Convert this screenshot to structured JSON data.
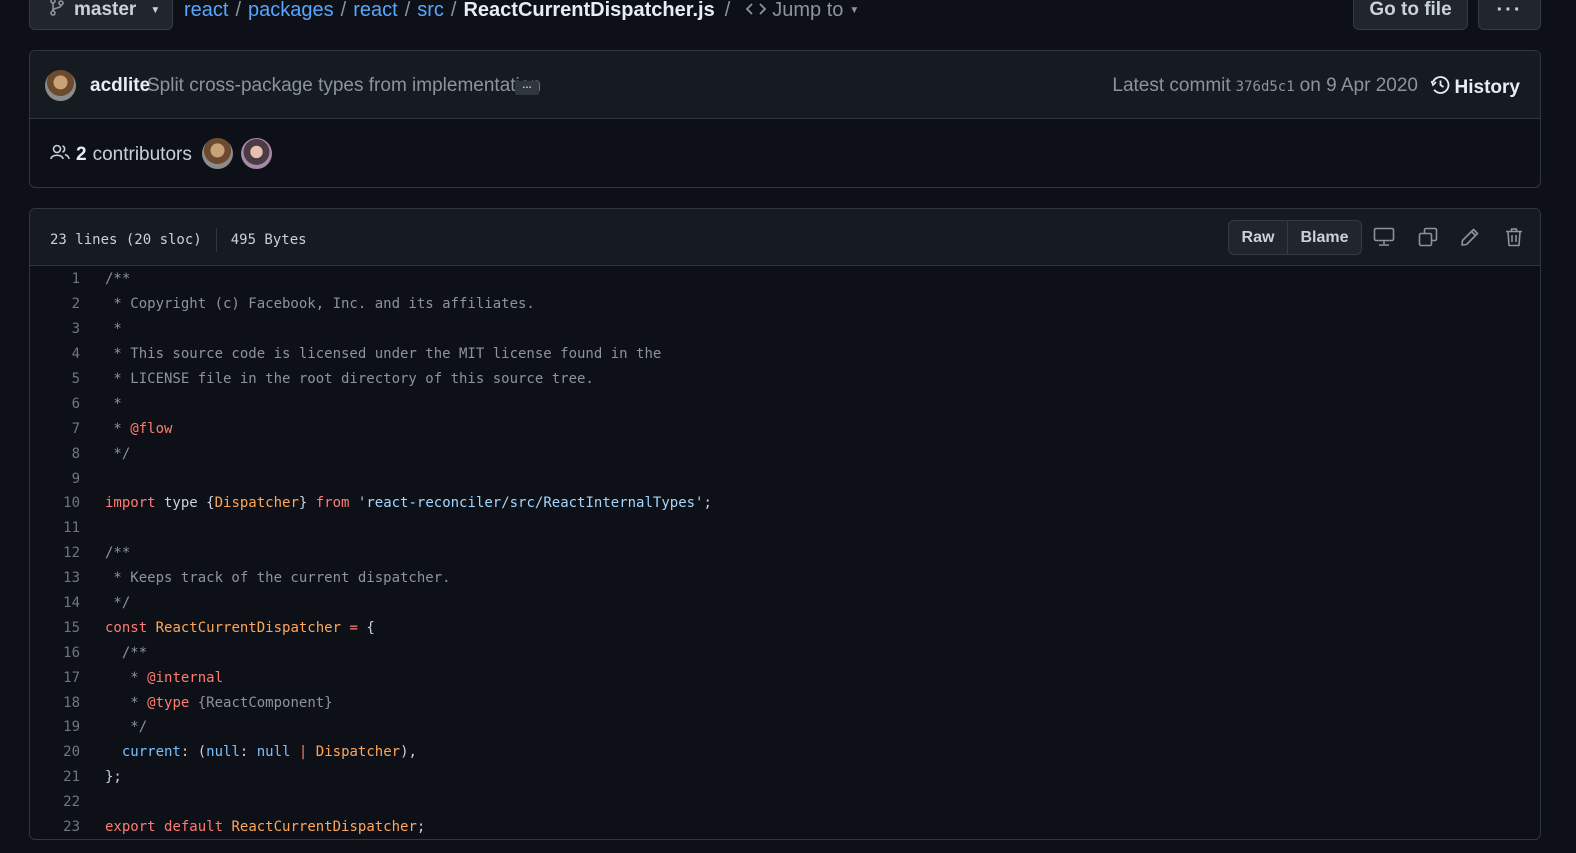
{
  "nav": {
    "branch": "master",
    "breadcrumb": [
      "react",
      "packages",
      "react",
      "src"
    ],
    "file_name": "ReactCurrentDispatcher.js",
    "jump_to": "Jump to",
    "go_to_file": "Go to file",
    "more": "···"
  },
  "commit": {
    "author": "acdlite",
    "message": "Split cross-package types from implementation",
    "ellipsis": "…",
    "latest_label": "Latest commit",
    "sha": "376d5c1",
    "date": "on 9 Apr 2020",
    "history": "History"
  },
  "contributors": {
    "count": "2",
    "label": "contributors"
  },
  "file": {
    "lines_info": "23 lines (20 sloc)",
    "size": "495 Bytes",
    "raw": "Raw",
    "blame": "Blame",
    "icons": [
      "desktop-icon",
      "copy-icon",
      "pencil-icon",
      "trash-icon"
    ]
  },
  "code": [
    {
      "n": "1",
      "parts": [
        [
          "c",
          "/**"
        ]
      ]
    },
    {
      "n": "2",
      "parts": [
        [
          "c",
          " * Copyright (c) Facebook, Inc. and its affiliates."
        ]
      ]
    },
    {
      "n": "3",
      "parts": [
        [
          "c",
          " *"
        ]
      ]
    },
    {
      "n": "4",
      "parts": [
        [
          "c",
          " * This source code is licensed under the MIT license found in the"
        ]
      ]
    },
    {
      "n": "5",
      "parts": [
        [
          "c",
          " * LICENSE file in the root directory of this source tree."
        ]
      ]
    },
    {
      "n": "6",
      "parts": [
        [
          "c",
          " *"
        ]
      ]
    },
    {
      "n": "7",
      "parts": [
        [
          "c",
          " * "
        ],
        [
          "k",
          "@flow"
        ]
      ]
    },
    {
      "n": "8",
      "parts": [
        [
          "c",
          " */"
        ]
      ]
    },
    {
      "n": "9",
      "parts": []
    },
    {
      "n": "10",
      "parts": [
        [
          "k",
          "import"
        ],
        [
          "p",
          " type {"
        ],
        [
          "t",
          "Dispatcher"
        ],
        [
          "p",
          "} "
        ],
        [
          "k",
          "from"
        ],
        [
          "p",
          " "
        ],
        [
          "s",
          "'react-reconciler/src/ReactInternalTypes'"
        ],
        [
          "p",
          ";"
        ]
      ]
    },
    {
      "n": "11",
      "parts": []
    },
    {
      "n": "12",
      "parts": [
        [
          "c",
          "/**"
        ]
      ]
    },
    {
      "n": "13",
      "parts": [
        [
          "c",
          " * Keeps track of the current dispatcher."
        ]
      ]
    },
    {
      "n": "14",
      "parts": [
        [
          "c",
          " */"
        ]
      ]
    },
    {
      "n": "15",
      "parts": [
        [
          "k",
          "const"
        ],
        [
          "p",
          " "
        ],
        [
          "t",
          "ReactCurrentDispatcher"
        ],
        [
          "p",
          " "
        ],
        [
          "k",
          "="
        ],
        [
          "p",
          " {"
        ]
      ]
    },
    {
      "n": "16",
      "parts": [
        [
          "c",
          "  /**"
        ]
      ]
    },
    {
      "n": "17",
      "parts": [
        [
          "c",
          "   * "
        ],
        [
          "k",
          "@internal"
        ]
      ]
    },
    {
      "n": "18",
      "parts": [
        [
          "c",
          "   * "
        ],
        [
          "k",
          "@type"
        ],
        [
          "c",
          " {ReactComponent}"
        ]
      ]
    },
    {
      "n": "19",
      "parts": [
        [
          "c",
          "   */"
        ]
      ]
    },
    {
      "n": "20",
      "parts": [
        [
          "p",
          "  "
        ],
        [
          "v",
          "current"
        ],
        [
          "p",
          ": ("
        ],
        [
          "v",
          "null"
        ],
        [
          "p",
          ": "
        ],
        [
          "v",
          "null"
        ],
        [
          "p",
          " "
        ],
        [
          "k",
          "|"
        ],
        [
          "p",
          " "
        ],
        [
          "t",
          "Dispatcher"
        ],
        [
          "p",
          "),"
        ]
      ]
    },
    {
      "n": "21",
      "parts": [
        [
          "p",
          "};"
        ]
      ]
    },
    {
      "n": "22",
      "parts": []
    },
    {
      "n": "23",
      "parts": [
        [
          "k",
          "export"
        ],
        [
          "p",
          " "
        ],
        [
          "k",
          "default"
        ],
        [
          "p",
          " "
        ],
        [
          "t",
          "ReactCurrentDispatcher"
        ],
        [
          "p",
          ";"
        ]
      ]
    }
  ],
  "colors": {
    "background": "#0d1117",
    "panel": "#161b22",
    "border": "#30363d",
    "link": "#58a6ff",
    "keyword": "#ff7b72",
    "entity": "#ffa657",
    "string": "#a5d6ff",
    "constant": "#79c0ff",
    "comment": "#8b949e"
  }
}
